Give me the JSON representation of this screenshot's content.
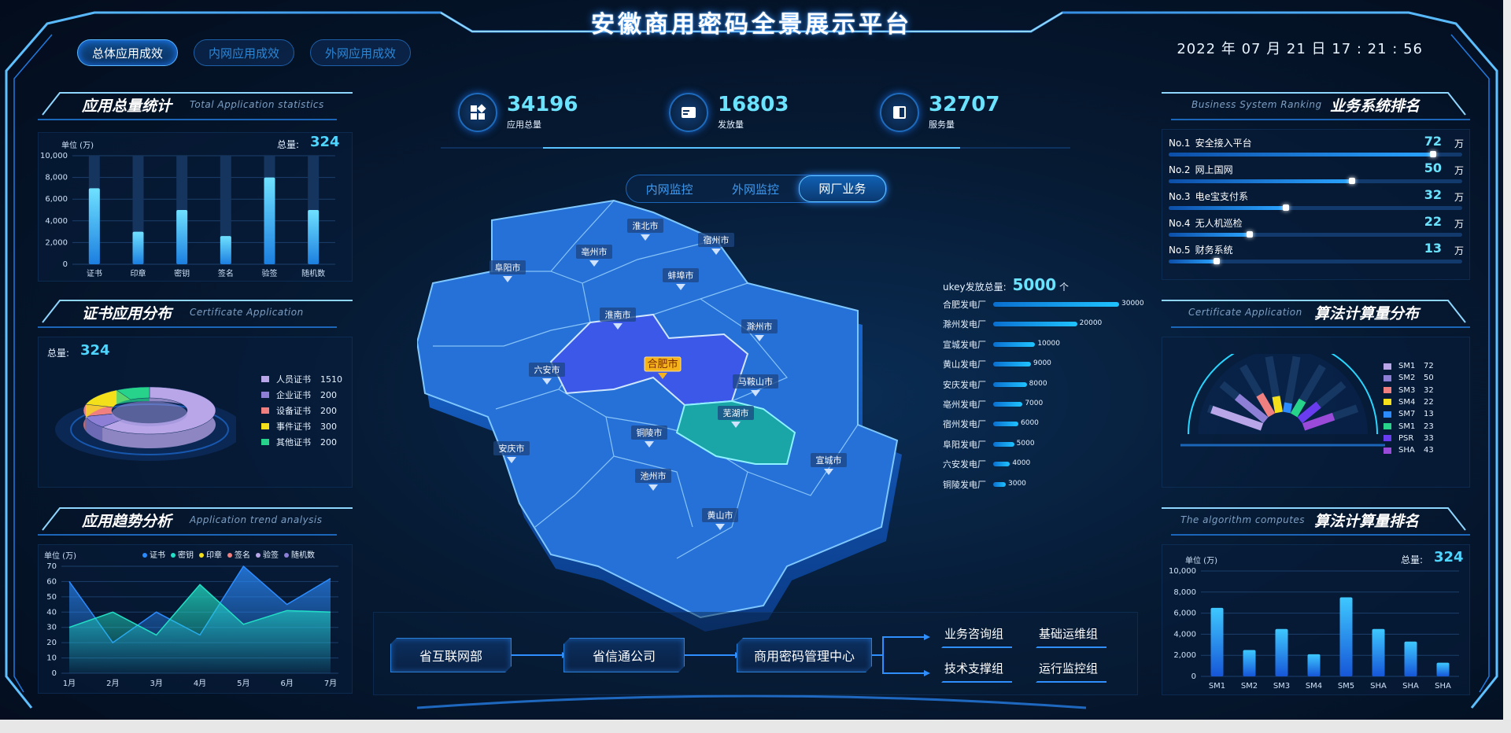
{
  "header": {
    "title": "安徽商用密码全景展示平台",
    "datetime": "2022 年 07 月 21 日 17 : 21 : 56",
    "tabs": [
      "总体应用成效",
      "内网应用成效",
      "外网应用成效"
    ]
  },
  "kpis": [
    {
      "icon": "apps-icon",
      "value": "34196",
      "label": "应用总量"
    },
    {
      "icon": "card-icon",
      "value": "16803",
      "label": "发放量"
    },
    {
      "icon": "book-icon",
      "value": "32707",
      "label": "服务量"
    }
  ],
  "map": {
    "tabs": [
      "内网监控",
      "外网监控",
      "网厂业务"
    ],
    "active_tab": "网厂业务",
    "cities": [
      "淮北市",
      "宿州市",
      "亳州市",
      "蚌埠市",
      "阜阳市",
      "淮南市",
      "滁州市",
      "合肥市",
      "六安市",
      "马鞍山市",
      "芜湖市",
      "铜陵市",
      "安庆市",
      "池州市",
      "宣城市",
      "黄山市"
    ],
    "highlight": "合肥市"
  },
  "ukey": {
    "title": "ukey发放总量:",
    "total": "5000",
    "unit": "个",
    "rows": [
      {
        "name": "合肥发电厂",
        "value": "30000",
        "num": 30000
      },
      {
        "name": "滁州发电厂",
        "value": "20000",
        "num": 20000
      },
      {
        "name": "宣城发电厂",
        "value": "10000",
        "num": 10000
      },
      {
        "name": "黄山发电厂",
        "value": "9000",
        "num": 9000
      },
      {
        "name": "安庆发电厂",
        "value": "8000",
        "num": 8000
      },
      {
        "name": "亳州发电厂",
        "value": "7000",
        "num": 7000
      },
      {
        "name": "宿州发电厂",
        "value": "6000",
        "num": 6000
      },
      {
        "name": "阜阳发电厂",
        "value": "5000",
        "num": 5000
      },
      {
        "name": "六安发电厂",
        "value": "4000",
        "num": 4000
      },
      {
        "name": "铜陵发电厂",
        "value": "3000",
        "num": 3000
      }
    ]
  },
  "flow": {
    "boxes": [
      "省互联网部",
      "省信通公司",
      "商用密码管理中心"
    ],
    "groups": [
      "业务咨询组",
      "基础运维组",
      "技术支撑组",
      "运行监控组"
    ]
  },
  "panels": {
    "app_total": {
      "cn": "应用总量统计",
      "en": "Total Application statistics",
      "unit": "单位 (万)",
      "total_label": "总量:",
      "total": "324"
    },
    "cert_dist": {
      "cn": "证书应用分布",
      "en": "Certificate Application",
      "total_label": "总量:",
      "total": "324"
    },
    "trend": {
      "cn": "应用趋势分析",
      "en": "Application trend analysis",
      "unit": "单位 (万)"
    },
    "biz_rank": {
      "cn": "业务系统排名",
      "en": "Business System Ranking"
    },
    "algo_dist": {
      "cn": "算法计算量分布",
      "en": "Certificate Application"
    },
    "algo_rank": {
      "cn": "算法计算量排名",
      "en": "The algorithm computes",
      "unit": "单位 (万)",
      "total_label": "总量:",
      "total": "324"
    }
  },
  "chart_data": [
    {
      "type": "bar",
      "categories": [
        "证书",
        "印章",
        "密钥",
        "签名",
        "验签",
        "随机数"
      ],
      "values": [
        7000,
        3000,
        5000,
        2600,
        8000,
        5000
      ],
      "ylim": [
        0,
        10000
      ],
      "yticks": [
        "0",
        "2,000",
        "4,000",
        "6,000",
        "8,000",
        "10,000"
      ]
    },
    {
      "type": "pie",
      "slices": [
        {
          "name": "人员证书",
          "value": "1510",
          "num": 1510,
          "color": "#b9a6e8"
        },
        {
          "name": "企业证书",
          "value": "200",
          "num": 200,
          "color": "#8d7fd6"
        },
        {
          "name": "设备证书",
          "value": "200",
          "num": 200,
          "color": "#f08080"
        },
        {
          "name": "事件证书",
          "value": "300",
          "num": 300,
          "color": "#f3df1a"
        },
        {
          "name": "其他证书",
          "value": "200",
          "num": 200,
          "color": "#27d38a"
        }
      ]
    },
    {
      "type": "area",
      "categories": [
        "1月",
        "2月",
        "3月",
        "4月",
        "5月",
        "6月",
        "7月"
      ],
      "ylim": [
        0,
        70
      ],
      "yticks": [
        "0",
        "10",
        "20",
        "30",
        "40",
        "50",
        "60",
        "70"
      ],
      "legend": [
        "证书",
        "密钥",
        "印章",
        "签名",
        "验签",
        "随机数"
      ],
      "legend_colors": [
        "#2b8cff",
        "#22e0c6",
        "#f3df1a",
        "#f08080",
        "#b9a6e8",
        "#8d7fd6"
      ],
      "series": [
        {
          "name": "证书",
          "values": [
            60,
            20,
            40,
            25,
            70,
            45,
            62
          ],
          "color": "#2b8cff"
        },
        {
          "name": "密钥",
          "values": [
            30,
            40,
            25,
            58,
            32,
            41,
            40
          ],
          "color": "#22e0c6"
        }
      ]
    },
    {
      "type": "bar",
      "title": "业务系统排名",
      "categories": [
        "安全接入平台",
        "网上国网",
        "电e宝支付系",
        "无人机巡检",
        "财务系统"
      ],
      "ranks": [
        "No.1",
        "No.2",
        "No.3",
        "No.4",
        "No.5"
      ],
      "values": [
        72,
        50,
        32,
        22,
        13
      ],
      "unit": "万"
    },
    {
      "type": "bar",
      "title": "算法计算量分布",
      "categories": [
        "SM1",
        "SM2",
        "SM3",
        "SM4",
        "SM7",
        "SM1",
        "PSR",
        "SHA"
      ],
      "values": [
        72,
        50,
        32,
        22,
        13,
        23,
        33,
        43
      ],
      "colors": [
        "#b9a6e8",
        "#8d7fd6",
        "#f08080",
        "#f3df1a",
        "#2b8cff",
        "#27d38a",
        "#6a3cf0",
        "#9a4ad8"
      ]
    },
    {
      "type": "bar",
      "categories": [
        "SM1",
        "SM2",
        "SM3",
        "SM4",
        "SM5",
        "SHA",
        "SHA",
        "SHA"
      ],
      "values": [
        6500,
        2500,
        4500,
        2100,
        7500,
        4500,
        3300,
        1300
      ],
      "ylim": [
        0,
        10000
      ],
      "yticks": [
        "0",
        "2,000",
        "4,000",
        "6,000",
        "8,000",
        "10,000"
      ]
    }
  ]
}
